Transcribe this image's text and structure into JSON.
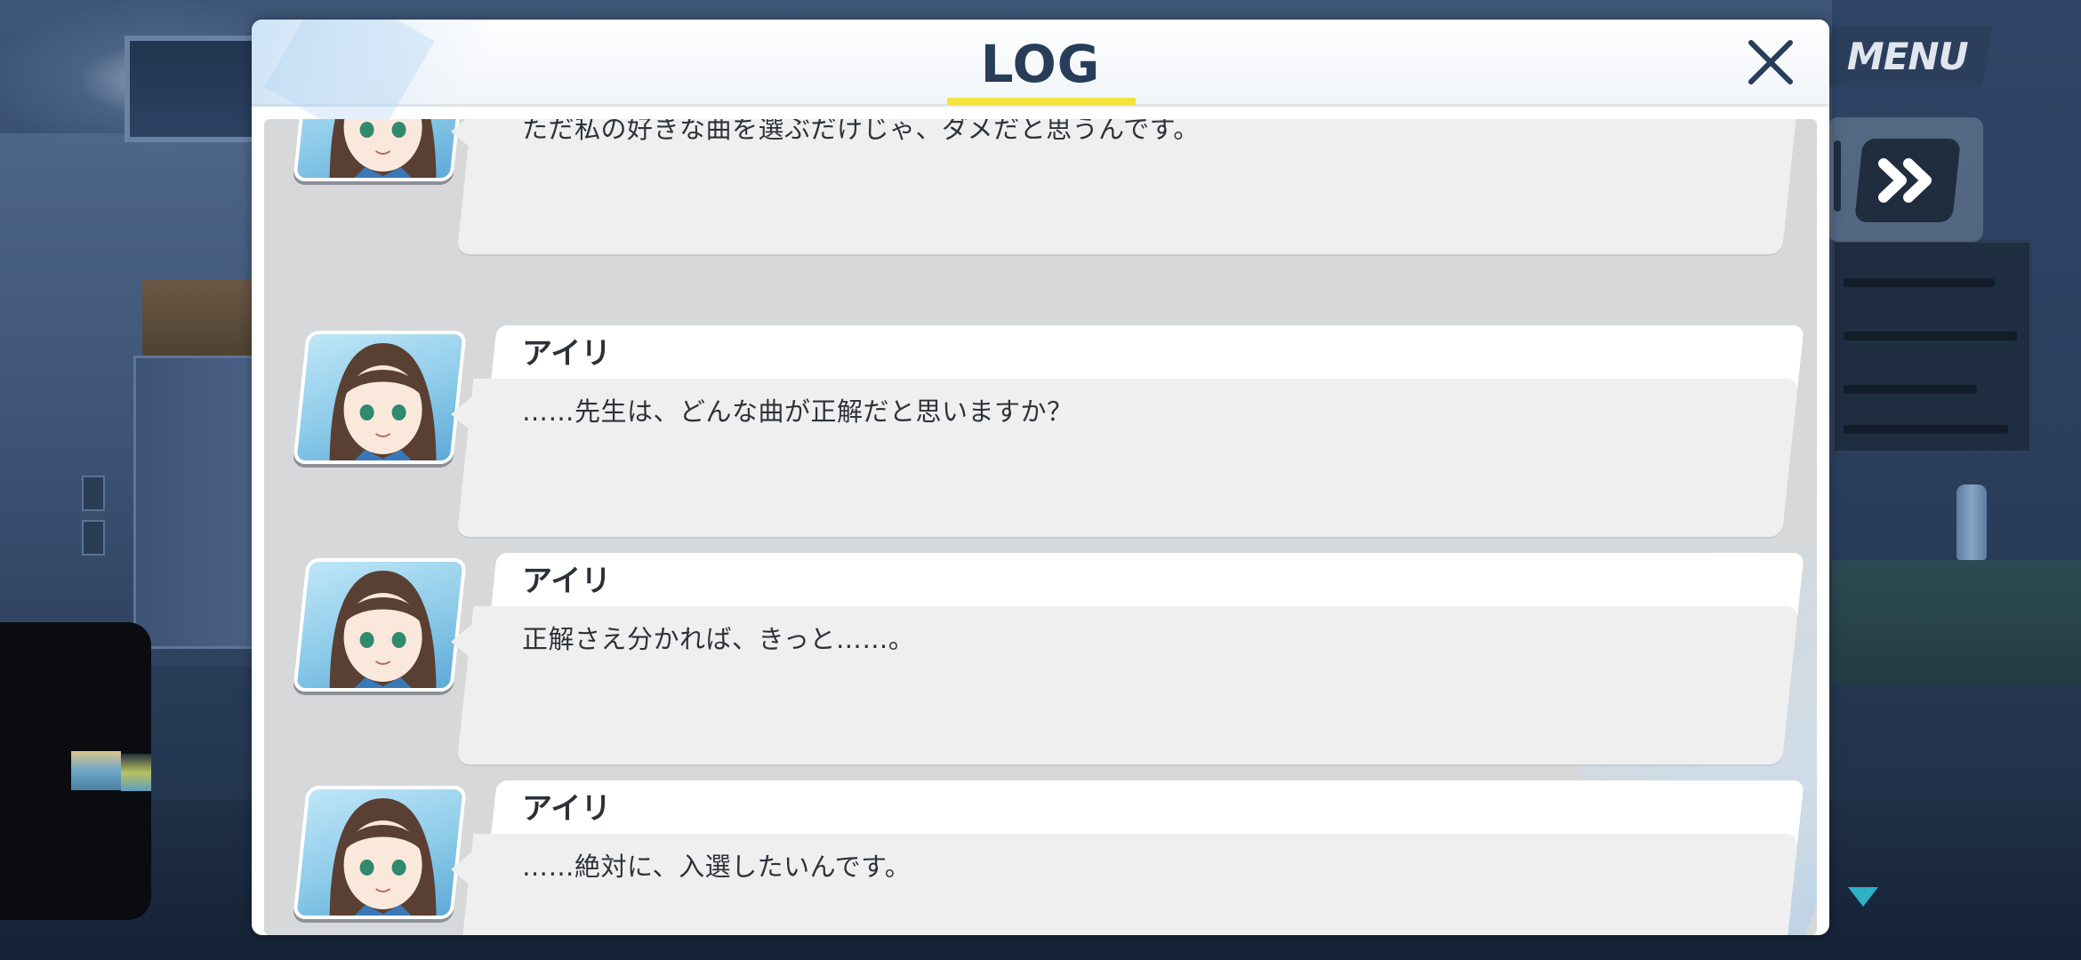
{
  "dialog": {
    "title": "LOG",
    "close_icon": "close-icon"
  },
  "hud": {
    "menu_label": "MENU",
    "skip_icon": "fast-forward-icon",
    "next_indicator_icon": "triangle-down-icon"
  },
  "entries": [
    {
      "speaker": "",
      "text": "ただ私の好きな曲を選ぶだけじゃ、ダメだと思うんです。"
    },
    {
      "speaker": "アイリ",
      "text": "……先生は、どんな曲が正解だと思いますか？"
    },
    {
      "speaker": "アイリ",
      "text": "正解さえ分かれば、きっと……。"
    },
    {
      "speaker": "アイリ",
      "text": "……絶対に、入選したいんです。"
    }
  ],
  "colors": {
    "title": "#283d5a",
    "underline": "#f4e23a",
    "bubble": "#efefef",
    "name_tab": "#ffffff",
    "log_body": "#d6d8da"
  }
}
